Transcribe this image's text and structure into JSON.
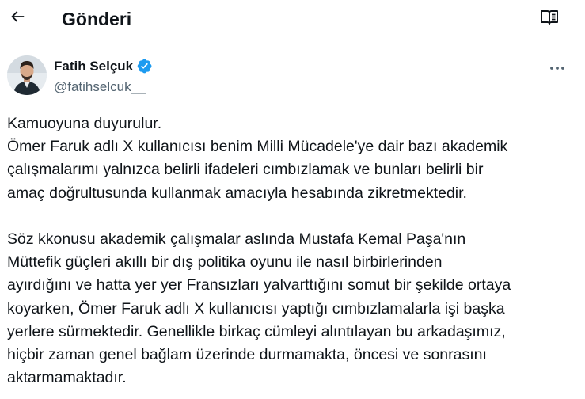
{
  "header": {
    "title": "Gönderi",
    "back_icon": "arrow-left-icon",
    "reader_icon": "open-book-icon"
  },
  "author": {
    "name": "Fatih Selçuk",
    "handle": "@fatihselcuk__",
    "verified": true,
    "verified_color": "#1d9bf0",
    "more_icon": "more-horizontal-icon"
  },
  "tweet": {
    "paragraphs": [
      [
        "Kamuoyuna duyurulur.",
        "Ömer Faruk adlı X kullanıcısı benim Milli Mücadele'ye dair bazı akademik",
        "çalışmalarımı yalnızca belirli ifadeleri cımbızlamak ve bunları belirli bir",
        "amaç doğrultusunda kullanmak amacıyla hesabında zikretmektedir."
      ],
      [
        "Söz kkonusu akademik çalışmalar aslında Mustafa Kemal Paşa'nın",
        "Müttefik güçleri akıllı bir dış politika oyunu ile nasıl birbirlerinden",
        "ayırdığını ve hatta yer yer Fransızları yalvarttığını somut bir şekilde ortaya",
        "koyarken, Ömer Faruk adlı X kullanıcısı yaptığı cımbızlamalarla işi başka",
        "yerlere sürmektedir. Genellikle birkaç cümleyi alıntılayan bu arkadaşımız,",
        "hiçbir zaman genel bağlam üzerinde durmamakta, öncesi ve sonrasını",
        "aktarmamaktadır."
      ]
    ]
  }
}
